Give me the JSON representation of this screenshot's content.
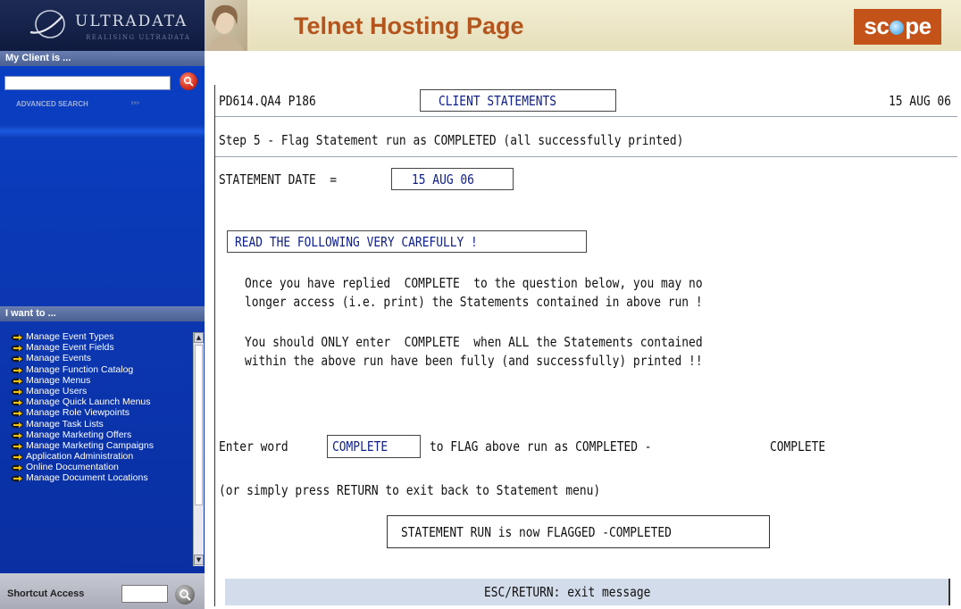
{
  "sidebar": {
    "logo": {
      "text": "ULTRADATA",
      "tagline": "REALISING ULTRADATA"
    },
    "client_header": "My Client is ...",
    "client_search": {
      "value": "",
      "button_icon": "search-icon"
    },
    "advanced_search_label": "ADVANCED SEARCH",
    "iwant_header": "I want to ...",
    "iwant_items": [
      {
        "label": "Manage Event Types",
        "icon": "arrow-icon"
      },
      {
        "label": "Manage Event Fields",
        "icon": "arrow-icon"
      },
      {
        "label": "Manage Events",
        "icon": "arrow-icon"
      },
      {
        "label": "Manage Function Catalog",
        "icon": "arrow-icon"
      },
      {
        "label": "Manage Menus",
        "icon": "arrow-icon"
      },
      {
        "label": "Manage Users",
        "icon": "arrow-icon"
      },
      {
        "label": "Manage Quick Launch Menus",
        "icon": "arrow-icon"
      },
      {
        "label": "Manage Role Viewpoints",
        "icon": "arrow-icon"
      },
      {
        "label": "Manage Task Lists",
        "icon": "arrow-icon"
      },
      {
        "label": "Manage Marketing Offers",
        "icon": "arrow-icon"
      },
      {
        "label": "Manage Marketing Campaigns",
        "icon": "arrow-icon"
      },
      {
        "label": "Application Administration",
        "icon": "arrow-icon"
      },
      {
        "label": "Online Documentation",
        "icon": "arrow-icon"
      },
      {
        "label": "Manage Document Locations",
        "icon": "arrow-icon"
      }
    ],
    "shortcut": {
      "label": "Shortcut Access",
      "value": ""
    }
  },
  "header": {
    "title": "Telnet Hosting Page",
    "brand_left": "sc",
    "brand_right": "pe"
  },
  "terminal": {
    "program_id": "PD614.QA4 P186",
    "screen_title": "CLIENT STATEMENTS",
    "date": "15 AUG 06",
    "step_text": "Step 5 - Flag Statement run as COMPLETED (all successfully printed)",
    "statement_date_label": "STATEMENT DATE  =",
    "statement_date_value": "15 AUG 06",
    "warning_box": "READ THE FOLLOWING VERY CAREFULLY !",
    "para1_line1": "Once you have replied  COMPLETE  to the question below, you may no",
    "para1_line2": "longer access (i.e. print) the Statements contained in above run !",
    "para2_line1": "You should ONLY enter  COMPLETE  when ALL the Statements contained",
    "para2_line2": "within the above run have been fully (and successfully) printed !!",
    "prompt_prefix": "Enter word",
    "prompt_keyword": "COMPLETE",
    "prompt_suffix": "to FLAG above run as COMPLETED -",
    "prompt_input": "COMPLETE",
    "return_hint": "(or simply press RETURN to exit back to Statement menu)",
    "result_message": "STATEMENT RUN is now FLAGGED -COMPLETED",
    "footer_message": "ESC/RETURN: exit message"
  }
}
